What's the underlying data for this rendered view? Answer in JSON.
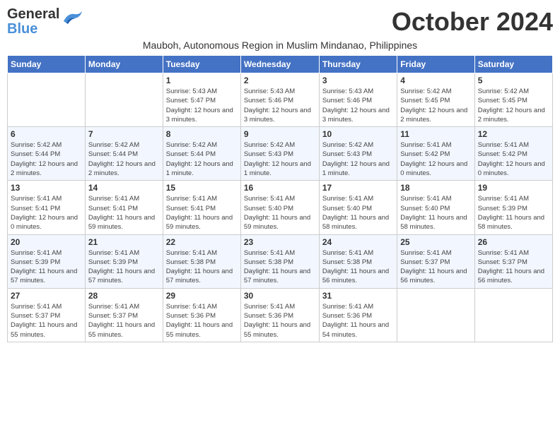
{
  "header": {
    "logo_general": "General",
    "logo_blue": "Blue",
    "title": "October 2024",
    "subtitle": "Mauboh, Autonomous Region in Muslim Mindanao, Philippines"
  },
  "weekdays": [
    "Sunday",
    "Monday",
    "Tuesday",
    "Wednesday",
    "Thursday",
    "Friday",
    "Saturday"
  ],
  "weeks": [
    [
      {
        "day": "",
        "info": ""
      },
      {
        "day": "",
        "info": ""
      },
      {
        "day": "1",
        "info": "Sunrise: 5:43 AM\nSunset: 5:47 PM\nDaylight: 12 hours and 3 minutes."
      },
      {
        "day": "2",
        "info": "Sunrise: 5:43 AM\nSunset: 5:46 PM\nDaylight: 12 hours and 3 minutes."
      },
      {
        "day": "3",
        "info": "Sunrise: 5:43 AM\nSunset: 5:46 PM\nDaylight: 12 hours and 3 minutes."
      },
      {
        "day": "4",
        "info": "Sunrise: 5:42 AM\nSunset: 5:45 PM\nDaylight: 12 hours and 2 minutes."
      },
      {
        "day": "5",
        "info": "Sunrise: 5:42 AM\nSunset: 5:45 PM\nDaylight: 12 hours and 2 minutes."
      }
    ],
    [
      {
        "day": "6",
        "info": "Sunrise: 5:42 AM\nSunset: 5:44 PM\nDaylight: 12 hours and 2 minutes."
      },
      {
        "day": "7",
        "info": "Sunrise: 5:42 AM\nSunset: 5:44 PM\nDaylight: 12 hours and 2 minutes."
      },
      {
        "day": "8",
        "info": "Sunrise: 5:42 AM\nSunset: 5:44 PM\nDaylight: 12 hours and 1 minute."
      },
      {
        "day": "9",
        "info": "Sunrise: 5:42 AM\nSunset: 5:43 PM\nDaylight: 12 hours and 1 minute."
      },
      {
        "day": "10",
        "info": "Sunrise: 5:42 AM\nSunset: 5:43 PM\nDaylight: 12 hours and 1 minute."
      },
      {
        "day": "11",
        "info": "Sunrise: 5:41 AM\nSunset: 5:42 PM\nDaylight: 12 hours and 0 minutes."
      },
      {
        "day": "12",
        "info": "Sunrise: 5:41 AM\nSunset: 5:42 PM\nDaylight: 12 hours and 0 minutes."
      }
    ],
    [
      {
        "day": "13",
        "info": "Sunrise: 5:41 AM\nSunset: 5:41 PM\nDaylight: 12 hours and 0 minutes."
      },
      {
        "day": "14",
        "info": "Sunrise: 5:41 AM\nSunset: 5:41 PM\nDaylight: 11 hours and 59 minutes."
      },
      {
        "day": "15",
        "info": "Sunrise: 5:41 AM\nSunset: 5:41 PM\nDaylight: 11 hours and 59 minutes."
      },
      {
        "day": "16",
        "info": "Sunrise: 5:41 AM\nSunset: 5:40 PM\nDaylight: 11 hours and 59 minutes."
      },
      {
        "day": "17",
        "info": "Sunrise: 5:41 AM\nSunset: 5:40 PM\nDaylight: 11 hours and 58 minutes."
      },
      {
        "day": "18",
        "info": "Sunrise: 5:41 AM\nSunset: 5:40 PM\nDaylight: 11 hours and 58 minutes."
      },
      {
        "day": "19",
        "info": "Sunrise: 5:41 AM\nSunset: 5:39 PM\nDaylight: 11 hours and 58 minutes."
      }
    ],
    [
      {
        "day": "20",
        "info": "Sunrise: 5:41 AM\nSunset: 5:39 PM\nDaylight: 11 hours and 57 minutes."
      },
      {
        "day": "21",
        "info": "Sunrise: 5:41 AM\nSunset: 5:39 PM\nDaylight: 11 hours and 57 minutes."
      },
      {
        "day": "22",
        "info": "Sunrise: 5:41 AM\nSunset: 5:38 PM\nDaylight: 11 hours and 57 minutes."
      },
      {
        "day": "23",
        "info": "Sunrise: 5:41 AM\nSunset: 5:38 PM\nDaylight: 11 hours and 57 minutes."
      },
      {
        "day": "24",
        "info": "Sunrise: 5:41 AM\nSunset: 5:38 PM\nDaylight: 11 hours and 56 minutes."
      },
      {
        "day": "25",
        "info": "Sunrise: 5:41 AM\nSunset: 5:37 PM\nDaylight: 11 hours and 56 minutes."
      },
      {
        "day": "26",
        "info": "Sunrise: 5:41 AM\nSunset: 5:37 PM\nDaylight: 11 hours and 56 minutes."
      }
    ],
    [
      {
        "day": "27",
        "info": "Sunrise: 5:41 AM\nSunset: 5:37 PM\nDaylight: 11 hours and 55 minutes."
      },
      {
        "day": "28",
        "info": "Sunrise: 5:41 AM\nSunset: 5:37 PM\nDaylight: 11 hours and 55 minutes."
      },
      {
        "day": "29",
        "info": "Sunrise: 5:41 AM\nSunset: 5:36 PM\nDaylight: 11 hours and 55 minutes."
      },
      {
        "day": "30",
        "info": "Sunrise: 5:41 AM\nSunset: 5:36 PM\nDaylight: 11 hours and 55 minutes."
      },
      {
        "day": "31",
        "info": "Sunrise: 5:41 AM\nSunset: 5:36 PM\nDaylight: 11 hours and 54 minutes."
      },
      {
        "day": "",
        "info": ""
      },
      {
        "day": "",
        "info": ""
      }
    ]
  ]
}
